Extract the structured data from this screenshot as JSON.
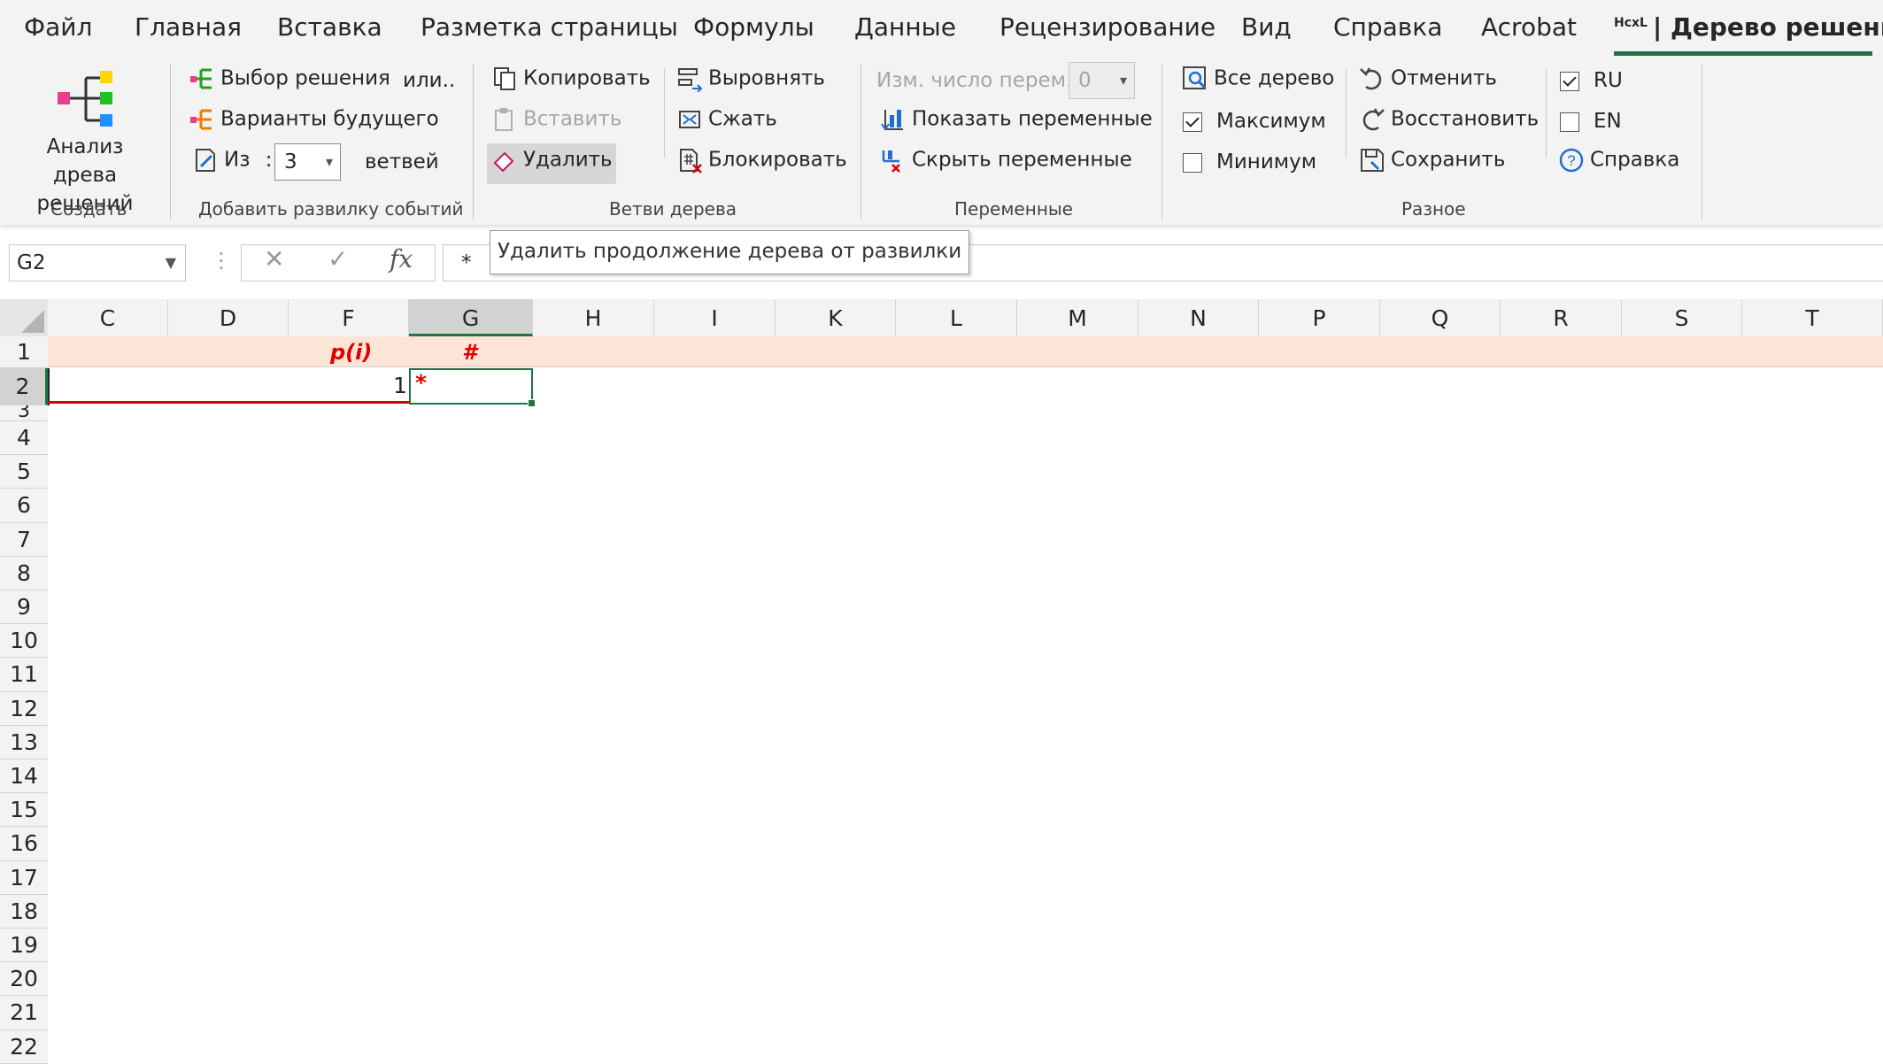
{
  "menu": {
    "tabs": [
      "Файл",
      "Главная",
      "Вставка",
      "Разметка страницы",
      "Формулы",
      "Данные",
      "Рецензирование",
      "Вид",
      "Справка",
      "Acrobat"
    ],
    "active_prefix": "HcxL",
    "active_tab": "| Дерево решений"
  },
  "ribbon": {
    "create": {
      "button": "Анализ древа решений",
      "group": "Создать"
    },
    "fork": {
      "decision": "Выбор решения",
      "or": "или..",
      "future": "Варианты будущего",
      "from_label": "Из",
      "colon": ":",
      "branches_value": "3",
      "branches_label": "ветвей",
      "group": "Добавить развилку событий"
    },
    "branches": {
      "copy": "Копировать",
      "paste": "Вставить",
      "delete": "Удалить",
      "align": "Выровнять",
      "compress": "Сжать",
      "lock": "Блокировать",
      "group": "Ветви дерева"
    },
    "variables": {
      "change_count": "Изм. число перем.",
      "count_value": "0",
      "show": "Показать переменные",
      "hide": "Скрыть переменные",
      "group": "Переменные"
    },
    "misc": {
      "whole_tree": "Все дерево",
      "maximum": "Максимум",
      "maximum_checked": true,
      "minimum": "Минимум",
      "minimum_checked": false,
      "undo": "Отменить",
      "redo": "Восстановить",
      "save": "Сохранить",
      "ru": "RU",
      "ru_checked": true,
      "en": "EN",
      "en_checked": false,
      "help": "Справка",
      "group": "Разное"
    }
  },
  "formula_bar": {
    "name_box": "G2",
    "cancel": "✕",
    "enter": "✓",
    "fx": "fx",
    "value": "*",
    "tooltip": "Удалить продолжение дерева от развилки"
  },
  "sheet": {
    "columns": [
      "C",
      "D",
      "F",
      "G",
      "H",
      "I",
      "K",
      "L",
      "M",
      "N",
      "P",
      "Q",
      "R",
      "S",
      "T"
    ],
    "selected_column": "G",
    "rows": [
      "1",
      "2",
      "3",
      "4",
      "5",
      "6",
      "7",
      "8",
      "9",
      "10",
      "11",
      "12",
      "13",
      "14",
      "15",
      "16",
      "17",
      "18",
      "19",
      "20",
      "21",
      "22"
    ],
    "header_p": "p(i)",
    "header_hash": "#",
    "f2_value": "1",
    "g2_value": "*"
  },
  "colors": {
    "accent": "#1e7145",
    "header_band": "#fce4d6",
    "red": "#e00000"
  }
}
